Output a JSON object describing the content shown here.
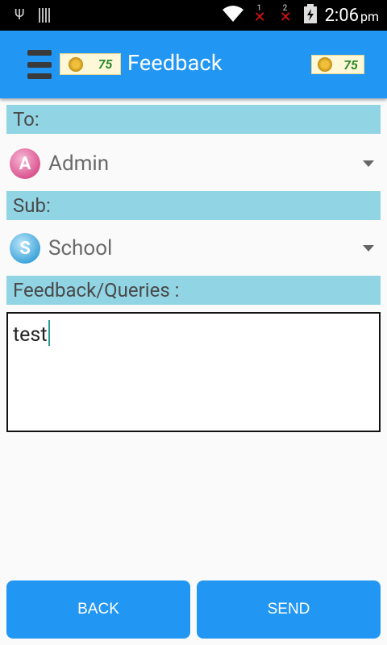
{
  "status_bar": {
    "time": "2:06",
    "ampm": "pm",
    "sim1": "1",
    "sim2": "2"
  },
  "app_bar": {
    "title": "Feedback"
  },
  "form": {
    "to_label": "To:",
    "to_value": "Admin",
    "to_initial": "A",
    "sub_label": "Sub:",
    "sub_value": "School",
    "sub_initial": "S",
    "feedback_label": "Feedback/Queries :",
    "feedback_value": "test"
  },
  "buttons": {
    "back": "BACK",
    "send": "SEND"
  },
  "colors": {
    "primary": "#2196f3",
    "label_bg": "#91d4e4"
  }
}
